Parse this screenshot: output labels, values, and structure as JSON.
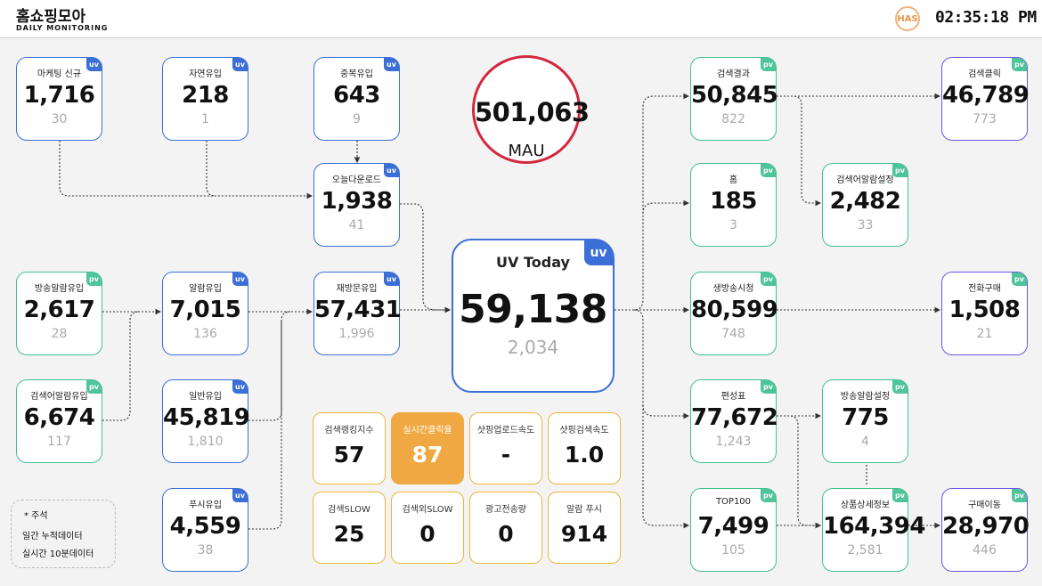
{
  "header": {
    "title": "홈쇼핑모아",
    "subtitle": "DAILY MONITORING",
    "logo_text": "HAS",
    "clock": "02:35:18 PM"
  },
  "mau": {
    "value": "501,063",
    "label": "MAU"
  },
  "nodes": {
    "marketing_new": {
      "label": "마케팅 신규",
      "value": "1,716",
      "sub": "30",
      "tag": "uv"
    },
    "organic": {
      "label": "자연유입",
      "value": "218",
      "sub": "1",
      "tag": "uv"
    },
    "duplicate": {
      "label": "중복유입",
      "value": "643",
      "sub": "9",
      "tag": "uv"
    },
    "today_download": {
      "label": "오늘다운로드",
      "value": "1,938",
      "sub": "41",
      "tag": "uv"
    },
    "broadcast_alarm_in": {
      "label": "방송알람유입",
      "value": "2,617",
      "sub": "28",
      "tag": "pv"
    },
    "alarm_in": {
      "label": "알람유입",
      "value": "7,015",
      "sub": "136",
      "tag": "uv"
    },
    "revisit": {
      "label": "재방문유입",
      "value": "57,431",
      "sub": "1,996",
      "tag": "uv"
    },
    "search_alarm_in": {
      "label": "검색어알람유입",
      "value": "6,674",
      "sub": "117",
      "tag": "pv"
    },
    "general_in": {
      "label": "일반유입",
      "value": "45,819",
      "sub": "1,810",
      "tag": "uv"
    },
    "push_in": {
      "label": "푸시유입",
      "value": "4,559",
      "sub": "38",
      "tag": "uv"
    },
    "uv_today": {
      "label": "UV Today",
      "value": "59,138",
      "sub": "2,034",
      "tag": "uv"
    },
    "search_result": {
      "label": "검색결과",
      "value": "50,845",
      "sub": "822",
      "tag": "pv"
    },
    "home": {
      "label": "홈",
      "value": "185",
      "sub": "3",
      "tag": "pv"
    },
    "live_view": {
      "label": "생방송시청",
      "value": "80,599",
      "sub": "748",
      "tag": "pv"
    },
    "schedule": {
      "label": "편성표",
      "value": "77,672",
      "sub": "1,243",
      "tag": "pv"
    },
    "top100": {
      "label": "TOP100",
      "value": "7,499",
      "sub": "105",
      "tag": "pv"
    },
    "search_alarm_set": {
      "label": "검색어알람설정",
      "value": "2,482",
      "sub": "33",
      "tag": "pv"
    },
    "broadcast_alarm_set": {
      "label": "방송알람설정",
      "value": "775",
      "sub": "4",
      "tag": "pv"
    },
    "product_detail": {
      "label": "상품상세정보",
      "value": "164,394",
      "sub": "2,581",
      "tag": "pv"
    },
    "search_click": {
      "label": "검색클릭",
      "value": "46,789",
      "sub": "773",
      "tag": "pv"
    },
    "phone_purchase": {
      "label": "전화구매",
      "value": "1,508",
      "sub": "21",
      "tag": "pv"
    },
    "purchase_move": {
      "label": "구매이동",
      "value": "28,970",
      "sub": "446",
      "tag": "pv"
    }
  },
  "metrics": [
    {
      "label": "검색랭킹지수",
      "value": "57"
    },
    {
      "label": "실시간클릭율",
      "value": "87",
      "highlight": true
    },
    {
      "label": "샷핑업로드속도",
      "value": "-"
    },
    {
      "label": "샷핑검색속도",
      "value": "1.0"
    },
    {
      "label": "검색SLOW",
      "value": "25"
    },
    {
      "label": "검색외SLOW",
      "value": "0"
    },
    {
      "label": "광고전송량",
      "value": "0"
    },
    {
      "label": "알람 푸시",
      "value": "914"
    }
  ],
  "notes": {
    "title": "* 주석",
    "line1": "일간 누적데이터",
    "line2": "실시간 10분데이터"
  },
  "colors": {
    "uv_border": "#3b6fd6",
    "pv_border": "#41c08c",
    "purple_border": "#7056e8",
    "mau_ring": "#d2283f",
    "metric_border": "#f0b43c",
    "metric_highlight": "#f0a843"
  }
}
